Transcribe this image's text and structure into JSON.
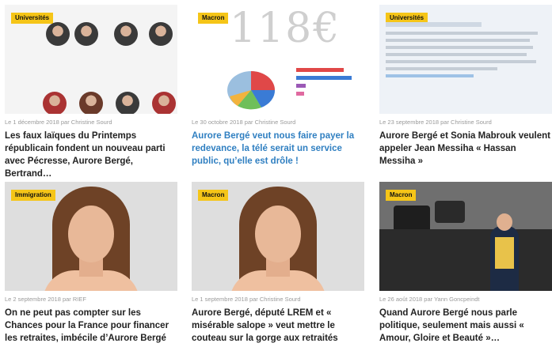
{
  "cards": [
    {
      "tag": "Universités",
      "meta": "Le 1 décembre 2018 par Christine Sourd",
      "title": "Les faux laïques du Printemps républicain fondent un nouveau parti avec Pécresse, Aurore Bergé, Bertrand…"
    },
    {
      "tag": "Macron",
      "meta": "Le 30 octobre 2018 par Christine Sourd",
      "title": "Aurore Bergé veut nous faire payer la redevance, la télé serait un service public, qu’elle est drôle !",
      "title_color": "#2f7fc1",
      "big_text": "118€"
    },
    {
      "tag": "Universités",
      "meta": "Le 23 septembre 2018 par Christine Sourd",
      "title": "Aurore Bergé et Sonia Mabrouk veulent appeler Jean Messiha « Hassan Messiha »"
    },
    {
      "tag": "Immigration",
      "meta": "Le 2 septembre 2018 par RIEF",
      "title": "On ne peut pas compter sur les Chances pour la France pour financer les retraites, imbécile d’Aurore Bergé"
    },
    {
      "tag": "Macron",
      "meta": "Le 1 septembre 2018 par Christine Sourd",
      "title": "Aurore Bergé, député LREM et « misérable salope » veut mettre le couteau sur la gorge aux retraités"
    },
    {
      "tag": "Macron",
      "meta": "Le 26 août 2018 par Yann Goncpeindt",
      "title": "Quand Aurore Bergé nous parle politique, seulement mais aussi « Amour, Gloire et Beauté »…"
    }
  ]
}
